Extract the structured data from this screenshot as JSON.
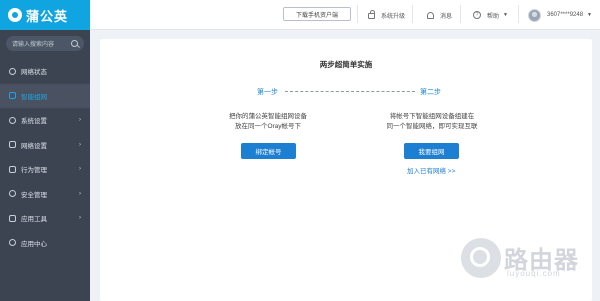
{
  "app": {
    "name": "蒲公英"
  },
  "sidebar": {
    "search_placeholder": "请输入搜索内容",
    "items": [
      {
        "label": "网络状态",
        "caret": ""
      },
      {
        "label": "智能组网",
        "caret": ""
      },
      {
        "label": "系统设置",
        "caret": "›"
      },
      {
        "label": "网络设置",
        "caret": "›"
      },
      {
        "label": "行为管理",
        "caret": "›"
      },
      {
        "label": "安全管理",
        "caret": "›"
      },
      {
        "label": "应用工具",
        "caret": "›"
      },
      {
        "label": "应用中心",
        "caret": ""
      }
    ],
    "active_index": 1
  },
  "header": {
    "download_label": "下载手机资户端",
    "upgrade_label": "系统升级",
    "messages_label": "消息",
    "help_label": "帮助",
    "account_label": "3607****9248"
  },
  "main": {
    "title": "两步超简单实施",
    "step1": {
      "label": "第一步",
      "line1": "把你的蒲公英智能组网设备",
      "line2": "放在同一个Oray帐号下",
      "button": "绑定帐号"
    },
    "step2": {
      "label": "第二步",
      "line1": "将帐号下智能组网设备组建在",
      "line2": "同一个智能网络，即可实现互联",
      "button": "我要组网",
      "link": "加入已有网络 >>"
    }
  },
  "watermark": {
    "text": "路由器",
    "url": "luyouqi.com"
  },
  "colors": {
    "accent": "#1d7fd2",
    "sidebar": "#3c4452",
    "logo_bg": "#10a5e0"
  }
}
